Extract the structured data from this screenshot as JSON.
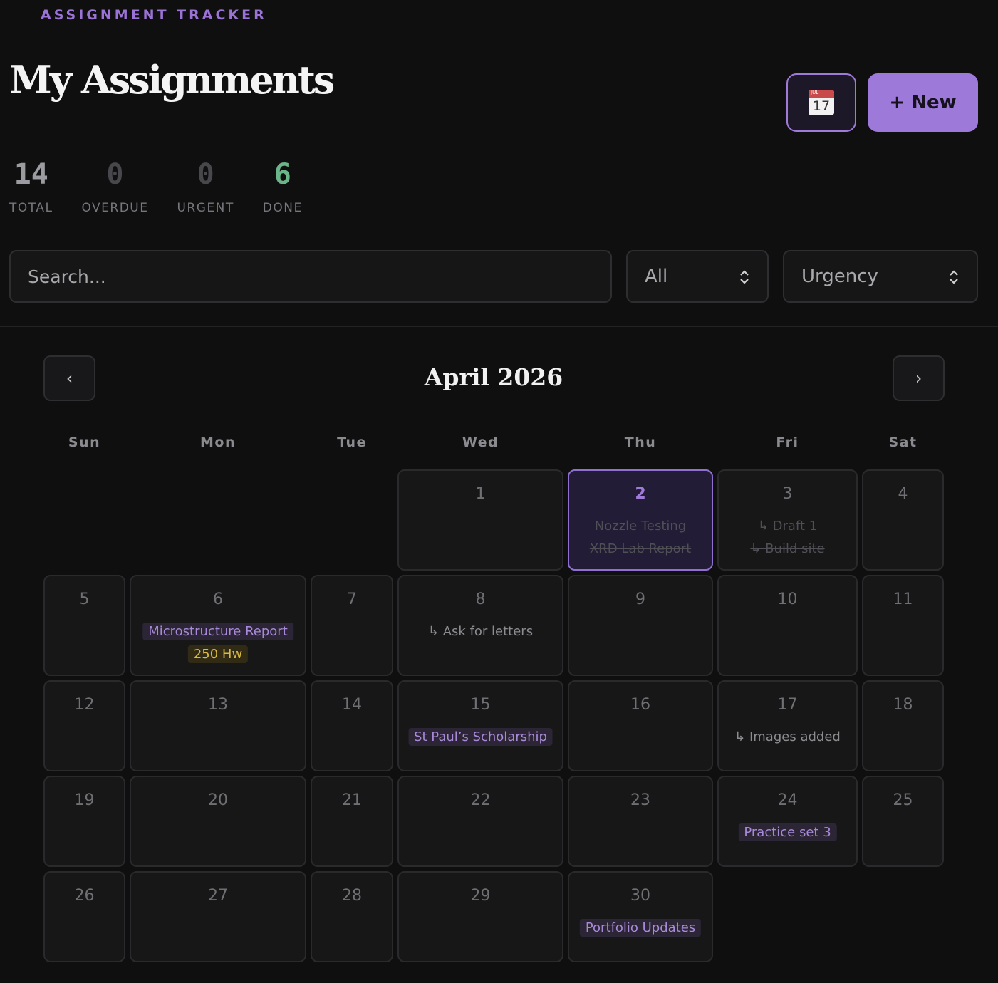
{
  "header": {
    "eyebrow": "ASSIGNMENT TRACKER",
    "title": "My Assignments",
    "new_button": "+ New",
    "calendar_icon": {
      "month": "JUL",
      "day": "17"
    }
  },
  "stats": [
    {
      "value": "14",
      "label": "TOTAL",
      "color": "#9c9ca0"
    },
    {
      "value": "0",
      "label": "OVERDUE",
      "color": "#48484c"
    },
    {
      "value": "0",
      "label": "URGENT",
      "color": "#48484c"
    },
    {
      "value": "6",
      "label": "DONE",
      "color": "#6bb58a"
    }
  ],
  "filters": {
    "search_placeholder": "Search...",
    "category_value": "All",
    "sort_value": "Urgency"
  },
  "calendar": {
    "month_label": "April 2026",
    "prev_label": "‹",
    "next_label": "›",
    "weekdays": [
      "Sun",
      "Mon",
      "Tue",
      "Wed",
      "Thu",
      "Fri",
      "Sat"
    ],
    "days": [
      {
        "day": "1",
        "events": []
      },
      {
        "day": "2",
        "today": true,
        "events": [
          {
            "text": "Nozzle Testing",
            "style": "done"
          },
          {
            "text": "XRD Lab Report",
            "style": "done"
          }
        ]
      },
      {
        "day": "3",
        "events": [
          {
            "text": "↳ Draft 1",
            "style": "done"
          },
          {
            "text": "↳ Build site",
            "style": "done"
          }
        ]
      },
      {
        "day": "4",
        "events": []
      },
      {
        "day": "5",
        "events": []
      },
      {
        "day": "6",
        "events": [
          {
            "text": "Microstructure Report",
            "style": "purple"
          },
          {
            "text": "250 Hw",
            "style": "yellow"
          }
        ]
      },
      {
        "day": "7",
        "events": []
      },
      {
        "day": "8",
        "events": [
          {
            "text": "↳ Ask for letters",
            "style": "sub"
          }
        ]
      },
      {
        "day": "9",
        "events": []
      },
      {
        "day": "10",
        "events": []
      },
      {
        "day": "11",
        "events": []
      },
      {
        "day": "12",
        "events": []
      },
      {
        "day": "13",
        "events": []
      },
      {
        "day": "14",
        "events": []
      },
      {
        "day": "15",
        "events": [
          {
            "text": "St Paul’s Scholarship",
            "style": "purple"
          }
        ]
      },
      {
        "day": "16",
        "events": []
      },
      {
        "day": "17",
        "events": [
          {
            "text": "↳ Images added",
            "style": "sub"
          }
        ]
      },
      {
        "day": "18",
        "events": []
      },
      {
        "day": "19",
        "events": []
      },
      {
        "day": "20",
        "events": []
      },
      {
        "day": "21",
        "events": []
      },
      {
        "day": "22",
        "events": []
      },
      {
        "day": "23",
        "events": []
      },
      {
        "day": "24",
        "events": [
          {
            "text": "Practice set 3",
            "style": "purple"
          }
        ]
      },
      {
        "day": "25",
        "events": []
      },
      {
        "day": "26",
        "events": []
      },
      {
        "day": "27",
        "events": []
      },
      {
        "day": "28",
        "events": []
      },
      {
        "day": "29",
        "events": []
      },
      {
        "day": "30",
        "events": [
          {
            "text": "Portfolio Updates",
            "style": "purple"
          }
        ]
      }
    ]
  }
}
